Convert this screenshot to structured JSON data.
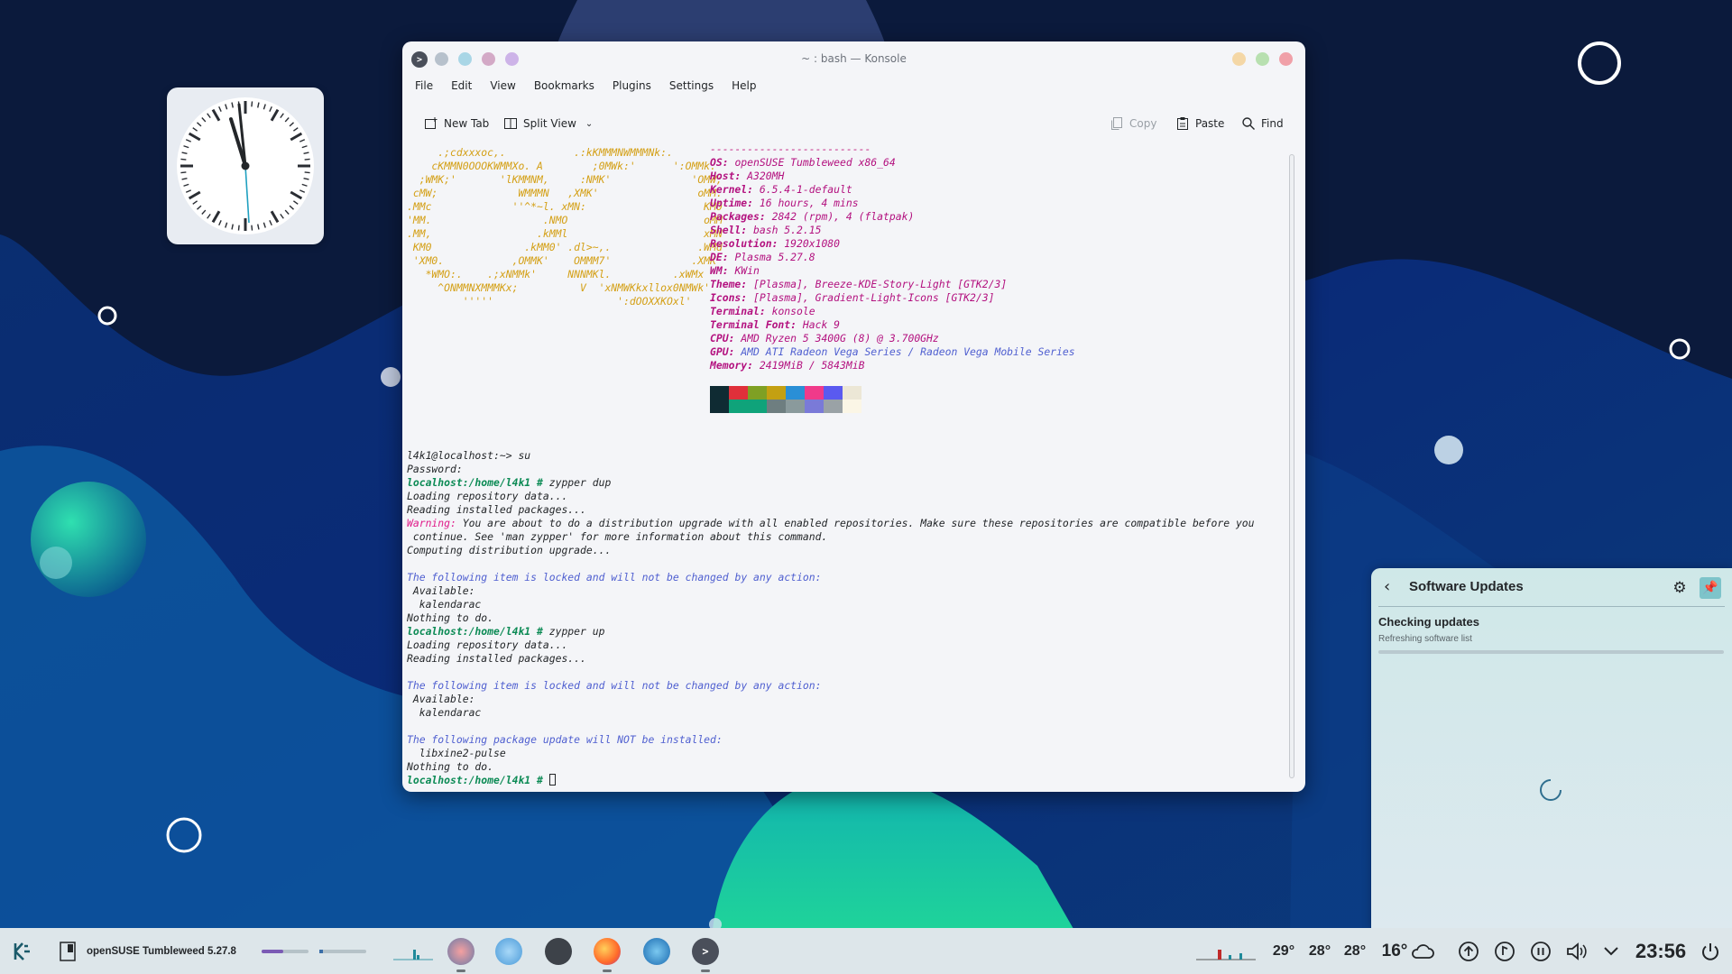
{
  "konsole": {
    "title": "~ : bash — Konsole",
    "menu": [
      "File",
      "Edit",
      "View",
      "Bookmarks",
      "Plugins",
      "Settings",
      "Help"
    ],
    "toolbar": {
      "new_tab": "New Tab",
      "split_view": "Split View",
      "copy": "Copy",
      "paste": "Paste",
      "find": "Find"
    },
    "logo_lines": [
      "     .;cdxxxoc,.           .:kKMMMNWMMMNk:.",
      "    cKMMN0OOOKWMMXo. A        ;0MWk:'      ':OMMk.",
      "  ;WMK;'       'lKMMNM,     :NMK'             'OMW;",
      " cMW;             WMMMN   ,XMK'                oMM.",
      ".MMc             ''^*~l. xMN:                   KM0",
      "'MM.                  .NMO                      oMM",
      ".MM,                 .kMMl                      xMN",
      " KM0               .kMM0' .dl>~,.              .WMd",
      " 'XM0.           ,OMMK'    OMMM7'             .XMK",
      "   *WMO:.    .;xNMMk'     NNNMKl.          .xWMx",
      "     ^ONMMNXMMMKx;          V  'xNMWKkxllox0NMWk'",
      "         '''''                    ':dOOXXKOxl'"
    ],
    "sysinfo": {
      "separator": "--------------------------",
      "rows": [
        {
          "key": "OS",
          "value": "openSUSE Tumbleweed x86_64"
        },
        {
          "key": "Host",
          "value": "A320MH"
        },
        {
          "key": "Kernel",
          "value": "6.5.4-1-default"
        },
        {
          "key": "Uptime",
          "value": "16 hours, 4 mins"
        },
        {
          "key": "Packages",
          "value": "2842 (rpm), 4 (flatpak)"
        },
        {
          "key": "Shell",
          "value": "bash 5.2.15"
        },
        {
          "key": "Resolution",
          "value": "1920x1080"
        },
        {
          "key": "DE",
          "value": "Plasma 5.27.8"
        },
        {
          "key": "WM",
          "value": "KWin"
        },
        {
          "key": "Theme",
          "value": "[Plasma], Breeze-KDE-Story-Light [GTK2/3]"
        },
        {
          "key": "Icons",
          "value": "[Plasma], Gradient-Light-Icons [GTK2/3]"
        },
        {
          "key": "Terminal",
          "value": "konsole"
        },
        {
          "key": "Terminal Font",
          "value": "Hack 9"
        },
        {
          "key": "CPU",
          "value": "AMD Ryzen 5 3400G (8) @ 3.700GHz"
        },
        {
          "key": "GPU",
          "value": "AMD ATI Radeon Vega Series / Radeon Vega Mobile Series"
        },
        {
          "key": "Memory",
          "value": "2419MiB / 5843MiB"
        }
      ],
      "palette_top": [
        "#0f2b33",
        "#e0303a",
        "#7fa024",
        "#c4a012",
        "#2a8fd6",
        "#f03a8a",
        "#5a5af0",
        "#ece7d6"
      ],
      "palette_bottom": [
        "#0f2b33",
        "#0fa37a",
        "#0fa37a",
        "#6e7e80",
        "#8a9a9c",
        "#7a7ad8",
        "#9aa2a6",
        "#fbf6e6"
      ]
    },
    "session": [
      {
        "type": "plain",
        "text": "l4k1@localhost:~> su"
      },
      {
        "type": "plain",
        "text": "Password:"
      },
      {
        "type": "prompt",
        "prompt": "localhost:/home/l4k1 #",
        "text": " zypper dup"
      },
      {
        "type": "plain",
        "text": "Loading repository data..."
      },
      {
        "type": "plain",
        "text": "Reading installed packages..."
      },
      {
        "type": "warn",
        "prompt": "Warning:",
        "text": " You are about to do a distribution upgrade with all enabled repositories. Make sure these repositories are compatible before you"
      },
      {
        "type": "plain",
        "text": " continue. See 'man zypper' for more information about this command."
      },
      {
        "type": "plain",
        "text": "Computing distribution upgrade..."
      },
      {
        "type": "plain",
        "text": ""
      },
      {
        "type": "info",
        "text": "The following item is locked and will not be changed by any action:"
      },
      {
        "type": "plain",
        "text": " Available:"
      },
      {
        "type": "plain",
        "text": "  kalendarac"
      },
      {
        "type": "plain",
        "text": "Nothing to do."
      },
      {
        "type": "prompt",
        "prompt": "localhost:/home/l4k1 #",
        "text": " zypper up"
      },
      {
        "type": "plain",
        "text": "Loading repository data..."
      },
      {
        "type": "plain",
        "text": "Reading installed packages..."
      },
      {
        "type": "plain",
        "text": ""
      },
      {
        "type": "info",
        "text": "The following item is locked and will not be changed by any action:"
      },
      {
        "type": "plain",
        "text": " Available:"
      },
      {
        "type": "plain",
        "text": "  kalendarac"
      },
      {
        "type": "plain",
        "text": ""
      },
      {
        "type": "info",
        "text": "The following package update will NOT be installed:"
      },
      {
        "type": "plain",
        "text": "  libxine2-pulse"
      },
      {
        "type": "plain",
        "text": "Nothing to do."
      },
      {
        "type": "prompt",
        "prompt": "localhost:/home/l4k1 #",
        "text": " "
      }
    ]
  },
  "updates": {
    "title": "Software Updates",
    "status": "Checking updates",
    "substatus": "Refreshing software list",
    "progress": 0.0
  },
  "taskbar": {
    "task_label": "openSUSE Tumbleweed 5.27.8",
    "temps": [
      "29°",
      "28°",
      "28°"
    ],
    "weather": "16°",
    "clock": "23:56"
  },
  "colors": {
    "terminal_prompt": "#0b8a54",
    "warning": "#e01b8a",
    "info_text": "#4f5fd0",
    "sysinfo": "#b3117f",
    "logo": "#d4a017"
  }
}
